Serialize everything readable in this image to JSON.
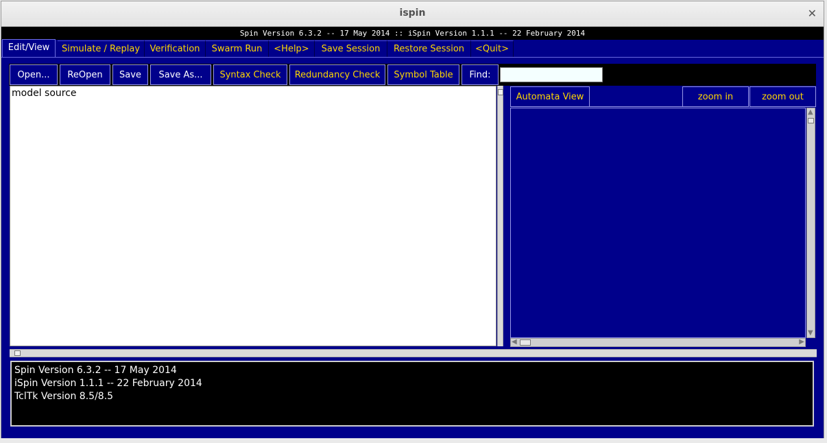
{
  "window": {
    "title": "ispin"
  },
  "banner": "Spin Version 6.3.2 -- 17 May 2014 :: iSpin Version 1.1.1 -- 22 February 2014",
  "tabs": [
    {
      "label": "Edit/View",
      "active": true
    },
    {
      "label": "Simulate / Replay"
    },
    {
      "label": "Verification"
    },
    {
      "label": "Swarm Run"
    },
    {
      "label": "<Help>"
    },
    {
      "label": "Save Session"
    },
    {
      "label": "Restore Session"
    },
    {
      "label": "<Quit>"
    }
  ],
  "toolbar": {
    "open": "Open...",
    "reopen": "ReOpen",
    "save": "Save",
    "save_as": "Save As...",
    "syntax_check": "Syntax Check",
    "redundancy_check": "Redundancy Check",
    "symbol_table": "Symbol Table",
    "find_label": "Find:",
    "find_value": ""
  },
  "editor": {
    "text": "model source"
  },
  "automata": {
    "view_button": "Automata View",
    "zoom_in": "zoom in",
    "zoom_out": "zoom out"
  },
  "console": {
    "lines": [
      "Spin Version 6.3.2 -- 17 May 2014",
      "iSpin Version 1.1.1 -- 22 February 2014",
      "TclTk Version 8.5/8.5"
    ]
  },
  "colors": {
    "background": "#00008b",
    "accent_text": "#ffd700",
    "console_bg": "#000000"
  },
  "icons": [
    "close-icon",
    "scroll-arrow-up-icon",
    "scroll-arrow-down-icon",
    "scroll-arrow-left-icon",
    "scroll-arrow-right-icon"
  ]
}
